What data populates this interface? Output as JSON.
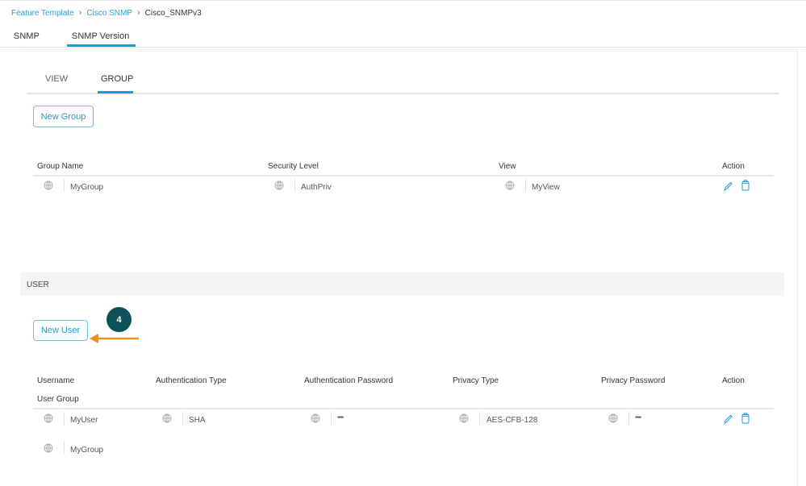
{
  "breadcrumb": {
    "items": [
      {
        "label": "Feature Template",
        "link": true
      },
      {
        "label": "Cisco SNMP",
        "link": true
      },
      {
        "label": "Cisco_SNMPv3",
        "link": false
      }
    ],
    "separator": ">"
  },
  "main_tabs": [
    {
      "label": "SNMP",
      "active": false
    },
    {
      "label": "SNMP Version",
      "active": true
    }
  ],
  "sub_tabs": [
    {
      "label": "VIEW",
      "active": false
    },
    {
      "label": "GROUP",
      "active": true
    }
  ],
  "group_section": {
    "new_button_label": "New Group",
    "columns": [
      "Group Name",
      "Security Level",
      "View",
      "Action"
    ],
    "rows": [
      {
        "group_name": "MyGroup",
        "security_level": "AuthPriv",
        "view": "MyView"
      }
    ]
  },
  "user_section": {
    "title": "USER",
    "new_button_label": "New User",
    "columns": [
      "Username",
      "Authentication Type",
      "Authentication Password",
      "Privacy Type",
      "Privacy Password",
      "Action",
      "User Group"
    ],
    "rows": [
      {
        "username": "MyUser",
        "auth_type": "SHA",
        "auth_password": "•••••",
        "privacy_type": "AES-CFB-128",
        "privacy_password": "•••••",
        "user_group": "MyGroup"
      }
    ]
  },
  "callout": {
    "number": "4",
    "color": "#0e5259",
    "arrow_color": "#f28c1e"
  },
  "icons": {
    "scope": "globe-icon",
    "edit": "pencil-icon",
    "delete": "trash-icon"
  },
  "colors": {
    "accent": "#1c9bd1",
    "button_border": "#6cc4e2",
    "section_bg": "#f5f5f5"
  }
}
